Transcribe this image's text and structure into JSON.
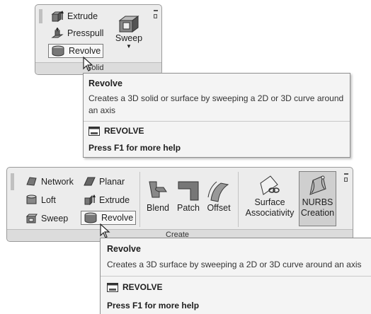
{
  "top_panel": {
    "items": [
      {
        "label": "Extrude",
        "icon": "extrude-icon"
      },
      {
        "label": "Presspull",
        "icon": "presspull-icon"
      },
      {
        "label": "Revolve",
        "icon": "revolve-icon"
      }
    ],
    "sweep_label": "Sweep",
    "footer_label": "Solid"
  },
  "top_tooltip": {
    "title": "Revolve",
    "description": "Creates a 3D solid or surface by sweeping a 2D or 3D curve around an axis",
    "command": "REVOLVE",
    "help": "Press F1 for more help"
  },
  "bottom_panel": {
    "left_items": [
      {
        "label": "Network",
        "icon": "network-icon"
      },
      {
        "label": "Loft",
        "icon": "loft-icon"
      },
      {
        "label": "Sweep",
        "icon": "sweep-icon"
      }
    ],
    "mid_items": [
      {
        "label": "Planar",
        "icon": "planar-icon"
      },
      {
        "label": "Extrude",
        "icon": "extrude-icon"
      },
      {
        "label": "Revolve",
        "icon": "revolve-icon"
      }
    ],
    "big_buttons": [
      {
        "label": "Blend"
      },
      {
        "label": "Patch"
      },
      {
        "label": "Offset"
      }
    ],
    "surface_assoc": {
      "line1": "Surface",
      "line2": "Associativity"
    },
    "nurbs": {
      "line1": "NURBS",
      "line2": "Creation"
    },
    "footer_label": "Create"
  },
  "bottom_tooltip": {
    "title": "Revolve",
    "description": "Creates a 3D surface by sweeping a 2D or 3D curve around an axis",
    "command": "REVOLVE",
    "help": "Press F1 for more help"
  }
}
